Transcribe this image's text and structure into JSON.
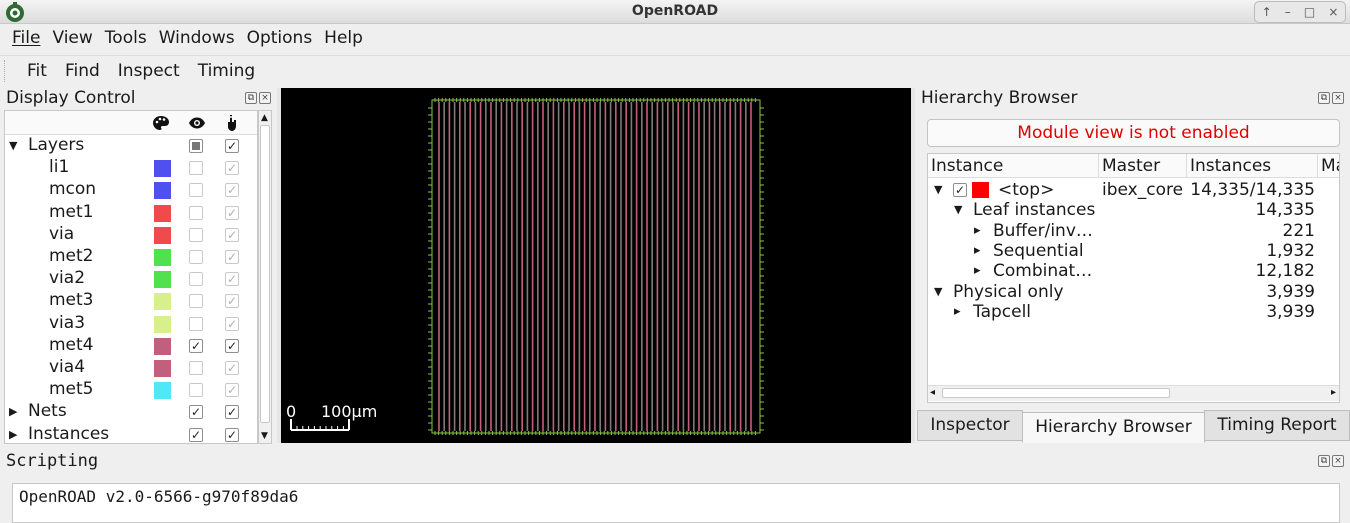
{
  "window": {
    "title": "OpenROAD",
    "controls": [
      "↑",
      "–",
      "□",
      "×"
    ]
  },
  "menu": [
    "File",
    "View",
    "Tools",
    "Windows",
    "Options",
    "Help"
  ],
  "toolbar": [
    "Fit",
    "Find",
    "Inspect",
    "Timing"
  ],
  "display_control": {
    "title": "Display Control",
    "rows": [
      {
        "label": "Layers",
        "type": "group",
        "expanded": true,
        "visible": "partial",
        "selectable": true
      },
      {
        "label": "li1",
        "color": "#5050f0",
        "visible": false,
        "selectable": true
      },
      {
        "label": "mcon",
        "color": "#5050f0",
        "visible": false,
        "selectable": true
      },
      {
        "label": "met1",
        "color": "#f04a4a",
        "visible": false,
        "selectable": true
      },
      {
        "label": "via",
        "color": "#f04a4a",
        "visible": false,
        "selectable": true
      },
      {
        "label": "met2",
        "color": "#50e050",
        "visible": false,
        "selectable": true
      },
      {
        "label": "via2",
        "color": "#50e050",
        "visible": false,
        "selectable": true
      },
      {
        "label": "met3",
        "color": "#d8f08c",
        "visible": false,
        "selectable": true
      },
      {
        "label": "via3",
        "color": "#d8f08c",
        "visible": false,
        "selectable": true
      },
      {
        "label": "met4",
        "color": "#c0607c",
        "visible": true,
        "selectable": true
      },
      {
        "label": "via4",
        "color": "#c0607c",
        "visible": false,
        "selectable": true
      },
      {
        "label": "met5",
        "color": "#50e8f8",
        "visible": false,
        "selectable": true
      },
      {
        "label": "Nets",
        "type": "group",
        "expanded": false,
        "visible": true,
        "selectable": true
      },
      {
        "label": "Instances",
        "type": "group",
        "expanded": false,
        "visible": true,
        "selectable": true
      }
    ]
  },
  "layout_view": {
    "scale_zero": "0",
    "scale_label": "100μm",
    "colors": {
      "background": "#000000",
      "stripe": "#c0607c",
      "row": "#7a7a7a",
      "pin": "#8bc34a"
    }
  },
  "hierarchy_browser": {
    "title": "Hierarchy Browser",
    "notice": "Module view is not enabled",
    "columns": [
      "Instance",
      "Master",
      "Instances",
      "Ma"
    ],
    "rows": [
      {
        "name": "<top>",
        "master": "ibex_core",
        "instances": "14,335/14,335",
        "indent": 0,
        "arrow": "▼",
        "checkbox": true
      },
      {
        "name": "Leaf instances",
        "master": "",
        "instances": "14,335",
        "indent": 1,
        "arrow": "▼"
      },
      {
        "name": "Buffer/inv…",
        "master": "",
        "instances": "221",
        "indent": 2,
        "arrow": "▸"
      },
      {
        "name": "Sequential",
        "master": "",
        "instances": "1,932",
        "indent": 2,
        "arrow": "▸"
      },
      {
        "name": "Combinat…",
        "master": "",
        "instances": "12,182",
        "indent": 2,
        "arrow": "▸"
      },
      {
        "name": "Physical only",
        "master": "",
        "instances": "3,939",
        "indent": 0,
        "arrow": "▼"
      },
      {
        "name": "Tapcell",
        "master": "",
        "instances": "3,939",
        "indent": 1,
        "arrow": "▸"
      }
    ]
  },
  "tabs": [
    {
      "label": "Inspector",
      "active": false
    },
    {
      "label": "Hierarchy Browser",
      "active": true
    },
    {
      "label": "Timing Report",
      "active": false
    }
  ],
  "scripting": {
    "title": "Scripting",
    "output": "OpenROAD v2.0-6566-g970f89da6"
  }
}
